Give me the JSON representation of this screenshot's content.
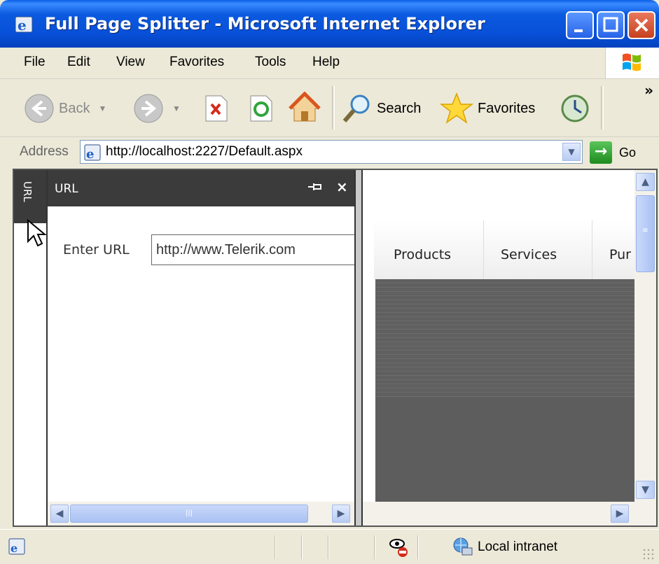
{
  "window": {
    "title": "Full Page Splitter - Microsoft Internet Explorer"
  },
  "menu": {
    "items": [
      "File",
      "Edit",
      "View",
      "Favorites",
      "Tools",
      "Help"
    ]
  },
  "toolbar": {
    "back_label": "Back",
    "search_label": "Search",
    "favorites_label": "Favorites",
    "overflow_label": "»"
  },
  "address": {
    "label": "Address",
    "url": "http://localhost:2227/Default.aspx",
    "go_label": "Go"
  },
  "splitter": {
    "side_tab_label": "URL",
    "left_pane": {
      "title": "URL",
      "pin_icon": "pin-icon",
      "close_glyph": "×",
      "url_label": "Enter URL",
      "url_value": "http://www.Telerik.com"
    },
    "right_pane": {
      "tabs": [
        "Products",
        "Services",
        "Pur"
      ]
    }
  },
  "status": {
    "zone_label": "Local intranet"
  },
  "colors": {
    "titlebar": "#0A5FE5",
    "pane_header": "#3B3B3B",
    "content_block": "#606060"
  }
}
